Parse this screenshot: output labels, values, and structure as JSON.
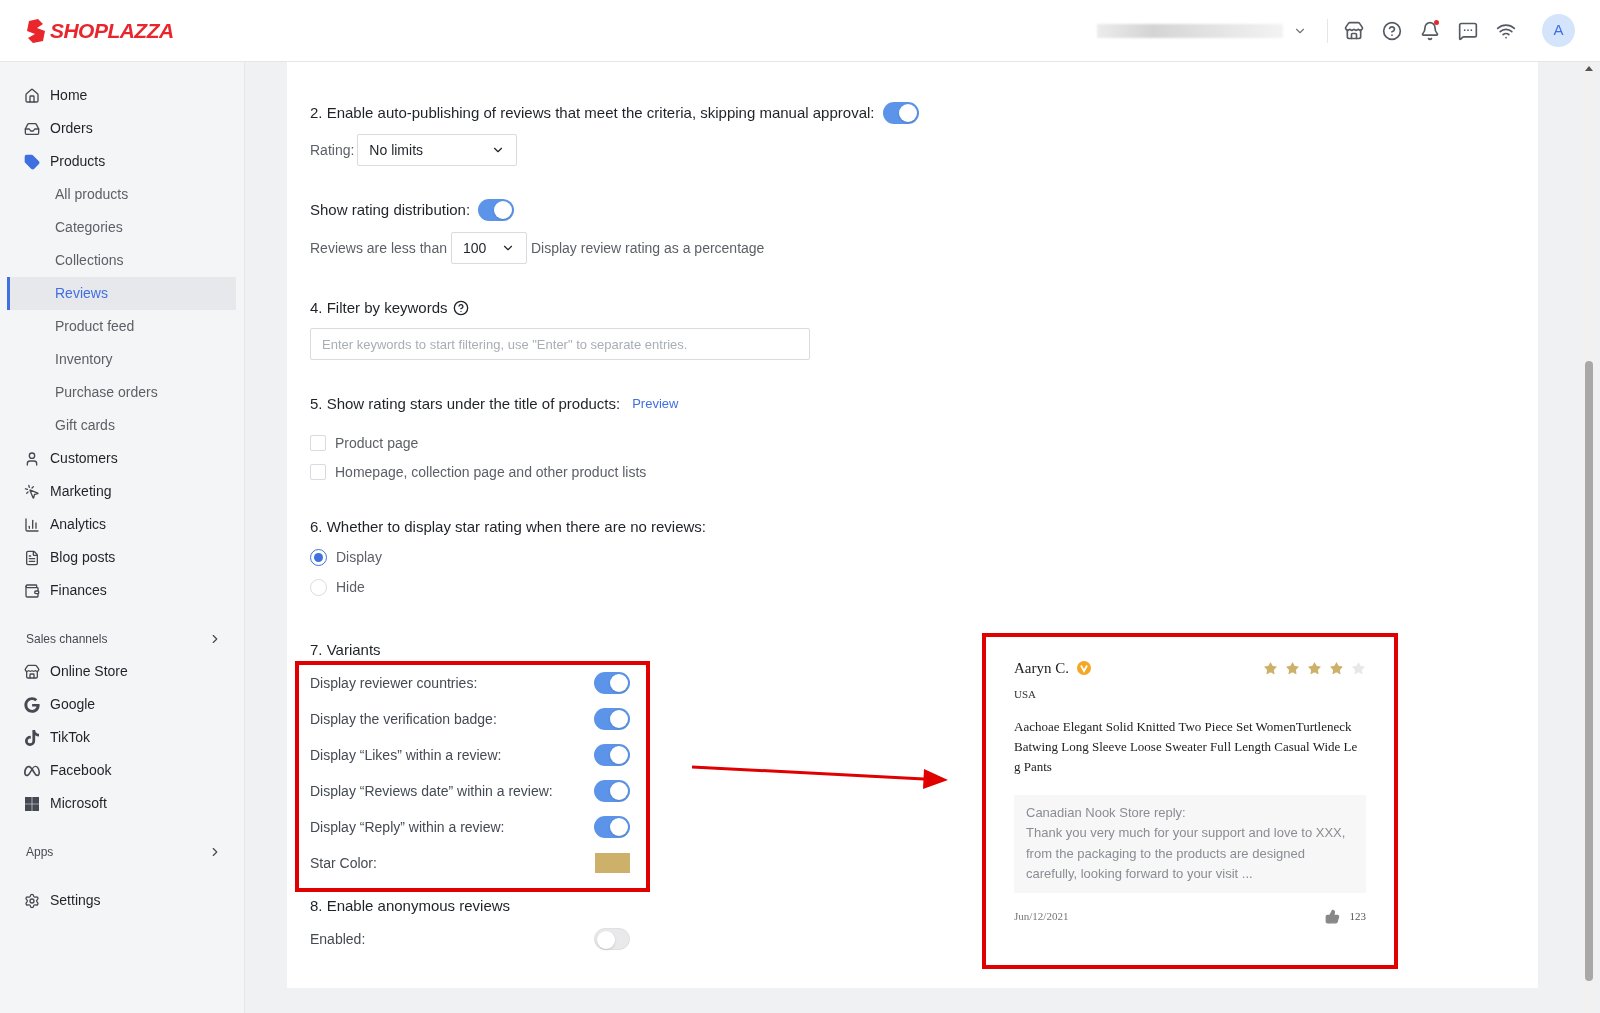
{
  "header": {
    "logo": "SHOPLAZZA",
    "avatar": "A",
    "unread_notifications": true
  },
  "sidebar": {
    "items": [
      {
        "label": "Home",
        "selected": false
      },
      {
        "label": "Orders",
        "selected": false
      },
      {
        "label": "Products",
        "selected": false,
        "expanded": true,
        "children": [
          {
            "label": "All products",
            "selected": false
          },
          {
            "label": "Categories",
            "selected": false
          },
          {
            "label": "Collections",
            "selected": false
          },
          {
            "label": "Reviews",
            "selected": true
          },
          {
            "label": "Product feed",
            "selected": false
          },
          {
            "label": "Inventory",
            "selected": false
          },
          {
            "label": "Purchase orders",
            "selected": false
          },
          {
            "label": "Gift cards",
            "selected": false
          }
        ]
      },
      {
        "label": "Customers",
        "selected": false
      },
      {
        "label": "Marketing",
        "selected": false
      },
      {
        "label": "Analytics",
        "selected": false
      },
      {
        "label": "Blog posts",
        "selected": false
      },
      {
        "label": "Finances",
        "selected": false
      }
    ],
    "sales_channels": {
      "title": "Sales channels",
      "items": [
        {
          "label": "Online Store",
          "selected": false
        },
        {
          "label": "Google",
          "selected": false
        },
        {
          "label": "TikTok",
          "selected": false
        },
        {
          "label": "Facebook",
          "selected": false
        },
        {
          "label": "Microsoft",
          "selected": false
        }
      ]
    },
    "apps": {
      "title": "Apps"
    },
    "settings": {
      "label": "Settings",
      "selected": false
    }
  },
  "auto_publish": {
    "label": "2. Enable auto-publishing of reviews that meet the criteria, skipping manual approval:",
    "on": true,
    "rating_label": "Rating:",
    "rating_value": "No limits"
  },
  "rating_distribution": {
    "label": "Show rating distribution:",
    "on": true,
    "prefix": "Reviews are less than",
    "value": "100",
    "suffix": "Display review rating as a percentage"
  },
  "keyword_filter": {
    "title": "4. Filter by keywords",
    "placeholder": "Enter keywords to start filtering, use \"Enter\" to separate entries."
  },
  "rating_stars": {
    "title": "5. Show rating stars under the title of products:",
    "link": "Preview",
    "options": [
      {
        "label": "Product page",
        "checked": false
      },
      {
        "label": "Homepage, collection page and other product lists",
        "checked": false
      }
    ]
  },
  "no_review_display": {
    "title": "6. Whether to display star rating when there are no reviews:",
    "options": [
      {
        "label": "Display",
        "selected": true
      },
      {
        "label": "Hide",
        "selected": false
      }
    ]
  },
  "variants": {
    "title": "7. Variants",
    "toggles": [
      {
        "label": "Display reviewer countries:",
        "on": true
      },
      {
        "label": "Display the verification badge:",
        "on": true
      },
      {
        "label": "Display “Likes” within a review:",
        "on": true
      },
      {
        "label": "Display “Reviews date” within a review:",
        "on": true
      },
      {
        "label": "Display “Reply” within a review:",
        "on": true
      }
    ],
    "star_color": {
      "label": "Star Color:",
      "color": "#cdb06a"
    }
  },
  "anonymous": {
    "title": "8. Enable anonymous reviews",
    "label": "Enabled:",
    "on": false
  },
  "review_preview": {
    "name": "Aaryn C.",
    "verified": true,
    "stars": 4,
    "country": "USA",
    "product": "Aachoae Elegant Solid Knitted Two Piece Set WomenTurtleneck Batwing Long Sleeve Loose Sweater Full Length Casual Wide Leg Pants",
    "reply_title": "Canadian Nook Store reply:",
    "reply": "Thank you very much for your support and love to XXX, from the packaging to the products are designed carefully, looking forward to your visit ...",
    "date": "Jun/12/2021",
    "likes": "123"
  }
}
